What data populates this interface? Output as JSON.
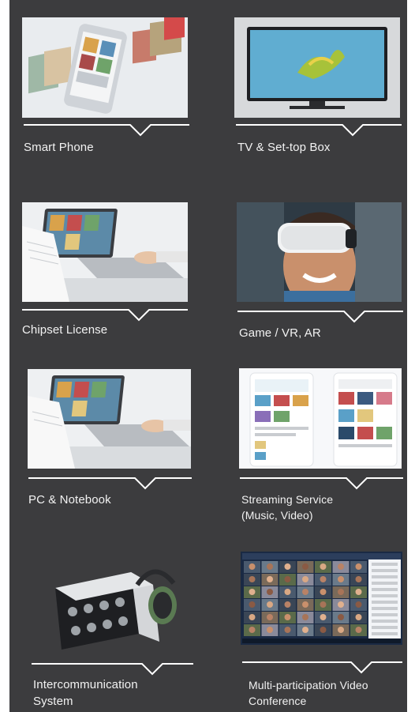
{
  "items": [
    {
      "label": "Smart Phone",
      "icon": "smartphone-apps-image"
    },
    {
      "label": "TV & Set-top Box",
      "icon": "tv-image"
    },
    {
      "label": "Chipset License",
      "icon": "laptop-document-image"
    },
    {
      "label": "Game / VR, AR",
      "icon": "vr-headset-image"
    },
    {
      "label": "PC & Notebook",
      "icon": "laptop-apps-image"
    },
    {
      "label": "Streaming Service\n(Music, Video)",
      "icon": "streaming-app-image"
    },
    {
      "label": "Intercommunication\nSystem",
      "icon": "intercom-headset-image"
    },
    {
      "label": "Multi-participation  Video\nConference",
      "icon": "video-conference-image"
    }
  ],
  "colors": {
    "panel": "#3c3c3e",
    "text": "#f2f2f2",
    "divider": "#ffffff"
  }
}
